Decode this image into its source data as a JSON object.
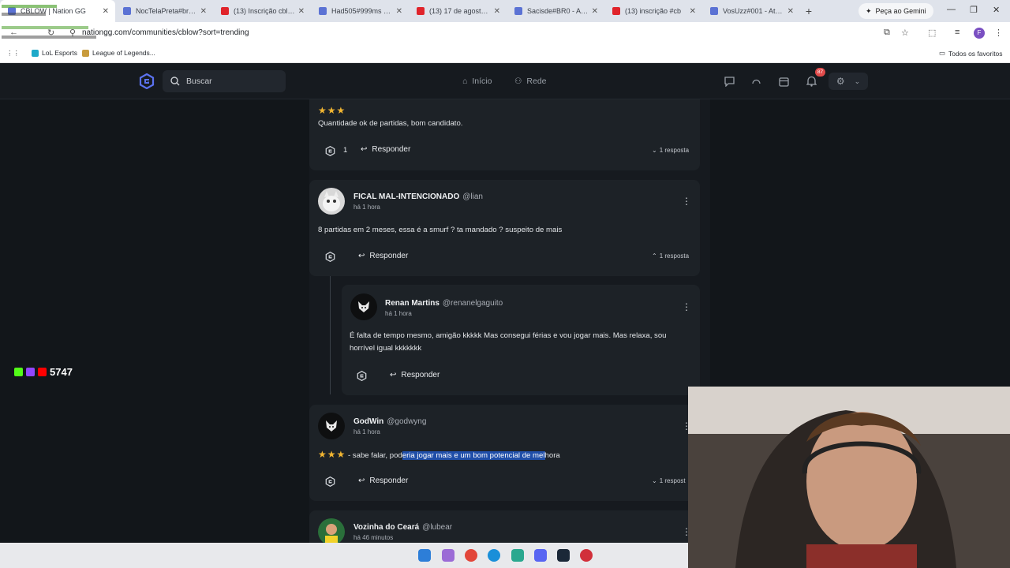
{
  "browser": {
    "tabs": [
      {
        "title": "CBLOW | Nation GG",
        "icon": "nationgg-icon",
        "active": true
      },
      {
        "title": "NocTelaPreta#br1 - Ati",
        "icon": "nationgg-icon"
      },
      {
        "title": "(13) Inscrição cblow 3",
        "icon": "youtube-icon"
      },
      {
        "title": "Had505#999ms - Atrib",
        "icon": "nationgg-icon"
      },
      {
        "title": "(13) 17 de agosto de",
        "icon": "youtube-icon"
      },
      {
        "title": "Sacisde#BR0 - Atribu",
        "icon": "nationgg-icon"
      },
      {
        "title": "(13) inscrição #cb",
        "icon": "youtube-icon"
      },
      {
        "title": "VosUzz#001 - Atribu",
        "icon": "nationgg-icon"
      }
    ],
    "gemini_label": "Peça ao Gemini",
    "url": "nationgg.com/communities/cblow?sort=trending",
    "profile_initial": "F",
    "bookmarks": [
      {
        "label": "LoL Esports"
      },
      {
        "label": "League of Legends..."
      }
    ],
    "all_bookmarks_label": "Todos os favoritos"
  },
  "app": {
    "search_placeholder": "Buscar",
    "nav": [
      {
        "label": "Início",
        "icon": "home-icon"
      },
      {
        "label": "Rede",
        "icon": "people-icon"
      }
    ],
    "notification_count": "87"
  },
  "feed": {
    "partial_comment": {
      "stars": "★★★",
      "text": "Quantidade ok de partidas, bom candidato.",
      "like_count": "1",
      "reply_label": "Responder",
      "replies_label": "1 resposta"
    },
    "comments": [
      {
        "author": "FICAL MAL-INTENCIONADO",
        "handle": "@lian",
        "time": "há 1 hora",
        "text": "8 partidas em 2 meses, essa é a smurf ? ta mandado ? suspeito de mais",
        "reply_label": "Responder",
        "replies_label": "1 resposta",
        "reply": {
          "author": "Renan Martins",
          "handle": "@renanelgaguito",
          "time": "há 1 hora",
          "text": "É falta de tempo mesmo, amigão kkkkk Mas consegui férias e vou jogar mais. Mas relaxa, sou horrível igual kkkkkkk",
          "reply_label": "Responder"
        }
      },
      {
        "author": "GodWin",
        "handle": "@godwyng",
        "time": "há 1 hora",
        "stars": "★★★",
        "text_pre": " - sabe falar, pod",
        "text_highlight": "eria jogar mais e um bom potencial de mel",
        "text_post": "hora",
        "reply_label": "Responder",
        "replies_label": "1 respost"
      },
      {
        "author": "Vozinha do Ceará",
        "handle": "@lubear",
        "time": "há 46 minutos"
      }
    ]
  },
  "overlay": {
    "follower_count": "5747"
  }
}
